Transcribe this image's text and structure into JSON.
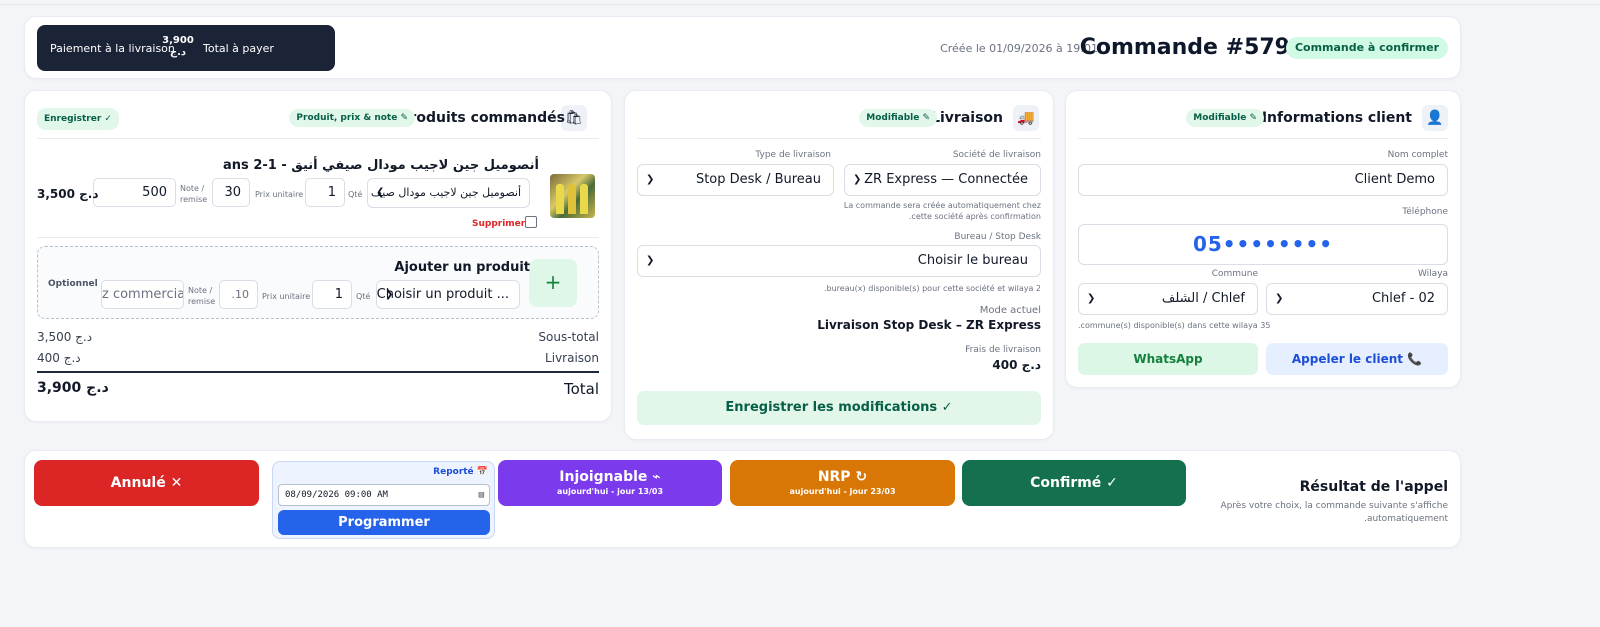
{
  "header": {
    "payment_method": "Paiement à la livraison",
    "total_amount": "3,900",
    "total_currency": "د.ج",
    "total_label": "Total à payer",
    "created": "Créée le 01/09/2026 à 19:01",
    "order_title": "Commande #579",
    "status": "Commande à confirmer"
  },
  "products": {
    "title": "Produits commandés",
    "icon": "shopping-bag-icon",
    "pill_edit": "Produit, prix & note ✎",
    "pill_save": "Enregistrer ✓",
    "item": {
      "name": "أنصوميل جين لاجيب مودال صيفي أنيق - 1-2 ans",
      "select_value": "أنصوميل جين لاجيب مودال صيف",
      "qty_label": "Qté",
      "qty": "1",
      "unit_price_label": "Prix unitaire",
      "unit_price": "30",
      "note_label": "Note / remise",
      "note_value": "500",
      "line_total": "3,500 د.ج",
      "delete_label": "Supprimer"
    },
    "add": {
      "title": "Ajouter un produit",
      "plus": "+",
      "select_placeholder": "Choisir un produit ...",
      "qty_label": "Qté",
      "qty": "1",
      "unit_price_label": "Prix unitaire",
      "unit_price": ".10",
      "note_label": "Note / remise",
      "note_placeholder": "z commercial",
      "optional": "Optionnel"
    },
    "subtotal_label": "Sous-total",
    "subtotal": "3,500 د.ج",
    "delivery_label": "Livraison",
    "delivery": "400 د.ج",
    "total_label": "Total",
    "total": "3,900 د.ج"
  },
  "delivery": {
    "title": "Livraison",
    "icon": "truck-icon",
    "pill": "Modifiable ✎",
    "company_label": "Société de livraison",
    "company": "ZR Express — Connectée",
    "type_label": "Type de livraison",
    "type": "Stop Desk / Bureau",
    "company_hint_1": "La commande sera créée automatiquement chez",
    "company_hint_2": ".cette société après confirmation",
    "office_label": "Bureau / Stop Desk",
    "office": "Choisir le bureau",
    "office_hint": ".bureau(x) disponible(s) pour cette société et wilaya 2",
    "mode_label": "Mode actuel",
    "mode": "Livraison Stop Desk – ZR Express",
    "fee_label": "Frais de livraison",
    "fee": "400 د.ج",
    "save_button": "Enregistrer les modifications ✓"
  },
  "client": {
    "title": "Informations client",
    "icon": "user-icon",
    "pill": "Modifiable ✎",
    "name_label": "Nom complet",
    "name": "Client Demo",
    "phone_label": "Téléphone",
    "phone": "05••••••••",
    "wilaya_label": "Wilaya",
    "wilaya": "Chlef - 02",
    "commune_label": "Commune",
    "commune": "الشلف / Chlef",
    "commune_hint": ".commune(s) disponible(s) dans cette wilaya 35",
    "whatsapp": "WhatsApp",
    "call": "Appeler le client 📞"
  },
  "result": {
    "title": "Résultat de l'appel",
    "subtitle": "Après votre choix, la commande suivante s'affiche automatiquement.",
    "cancel": "Annulé ✕",
    "reported_label": "Reporté 📅",
    "datetime": "08/09/2026 09:00 AM",
    "schedule": "Programmer",
    "unreachable": "Injoignable ⌁",
    "unreachable_sub": "aujourd'hui - jour 13/03",
    "nrp": "NRP ↻",
    "nrp_sub": "aujourd'hui - jour 23/03",
    "confirm": "Confirmé ✓"
  },
  "colors": {
    "cancel": "#dc2626",
    "unreachable": "#7c3aed",
    "nrp": "#d97706",
    "confirm": "#15704d",
    "schedule": "#2563eb"
  }
}
